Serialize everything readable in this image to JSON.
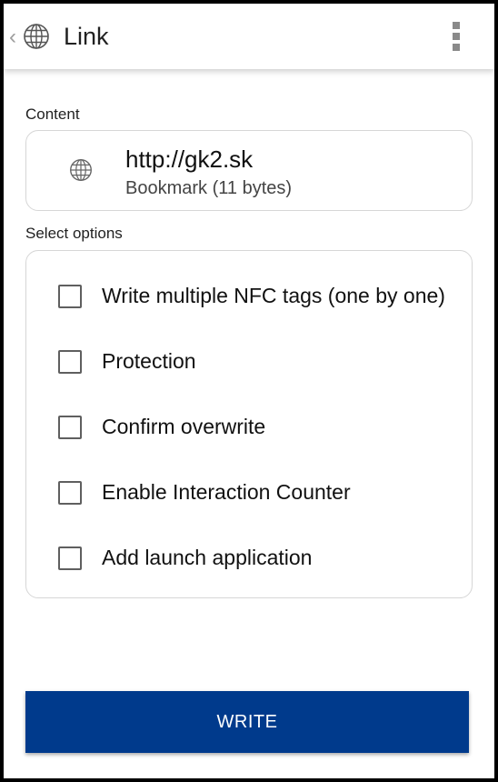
{
  "app_bar": {
    "title": "Link",
    "back_icon": "chevron-left-icon",
    "app_icon": "globe-icon",
    "menu_icon": "more-vert-icon"
  },
  "content_section": {
    "label": "Content",
    "icon": "globe-icon",
    "value": "http://gk2.sk",
    "subtitle": "Bookmark (11 bytes)"
  },
  "options_section": {
    "label": "Select options",
    "options": [
      {
        "label": "Write multiple NFC tags (one by one)",
        "checked": false
      },
      {
        "label": "Protection",
        "checked": false
      },
      {
        "label": "Confirm overwrite",
        "checked": false
      },
      {
        "label": "Enable Interaction Counter",
        "checked": false
      },
      {
        "label": "Add launch application",
        "checked": false
      }
    ]
  },
  "write_button": {
    "label": "WRITE",
    "color": "#003a8c"
  }
}
